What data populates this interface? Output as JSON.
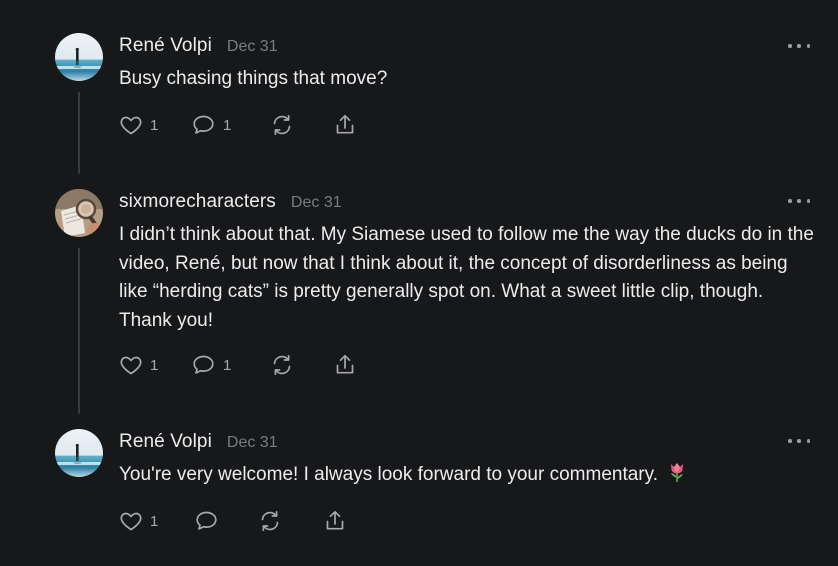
{
  "comments": [
    {
      "author": "René Volpi",
      "date": "Dec 31",
      "text": "Busy chasing things that move?",
      "likes": "1",
      "replies": "1",
      "avatar_icon": "beach-photo-avatar"
    },
    {
      "author": "sixmorecharacters",
      "date": "Dec 31",
      "text": "I didn’t think about that. My Siamese used to follow me the way the ducks do in the video, René, but now that I think about it, the concept of disorderliness as being like “herding cats” is pretty generally spot on. What a sweet little clip, though. Thank you!",
      "likes": "1",
      "replies": "1",
      "avatar_icon": "magnifier-photo-avatar"
    },
    {
      "author": "René Volpi",
      "date": "Dec 31",
      "text": "You're very welcome! I always look forward to your commentary.",
      "emoji": "tulip",
      "likes": "1",
      "replies": "",
      "avatar_icon": "beach-photo-avatar"
    }
  ],
  "colors": {
    "background": "#17181a",
    "text": "#ececed",
    "muted": "#7b7c80",
    "icon": "#a8a9ad",
    "thread_line": "#3a3b3e"
  },
  "icons": [
    "heart-icon",
    "comment-icon",
    "restack-icon",
    "share-icon",
    "more-icon"
  ]
}
